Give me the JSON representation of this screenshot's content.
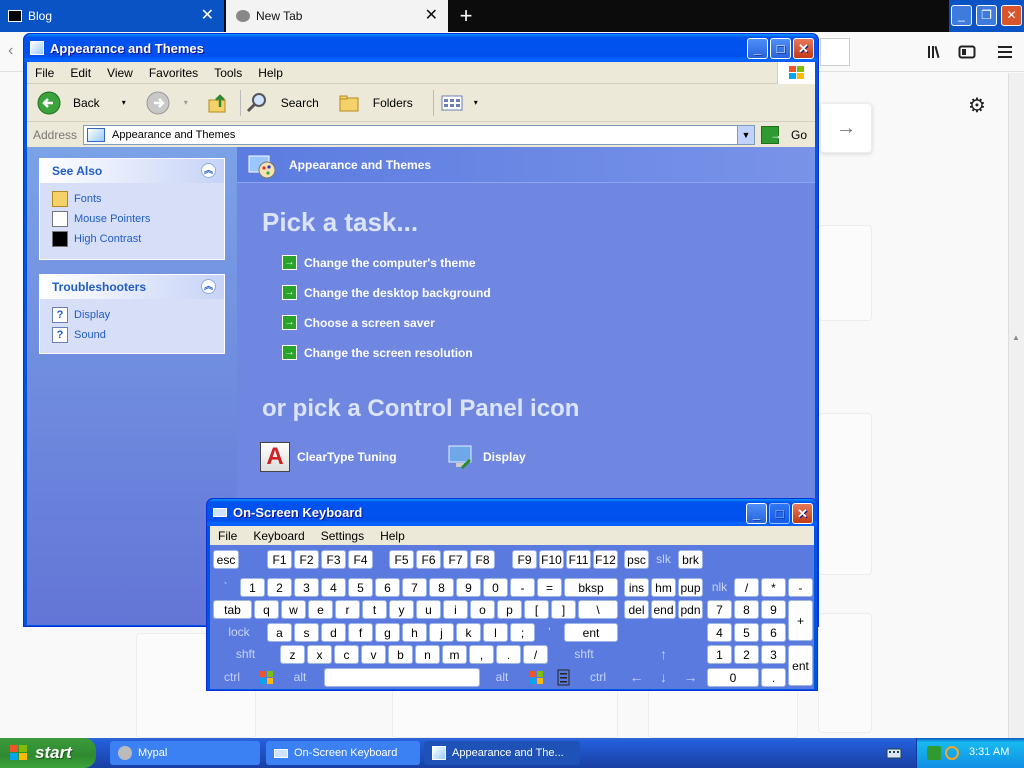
{
  "browser": {
    "tabs": [
      {
        "label": "Blog"
      },
      {
        "label": "New Tab"
      }
    ],
    "close_glyph": "✕",
    "new_tab_glyph": "+",
    "forward_glyph": "→",
    "settings_glyph": "⚙"
  },
  "explorer": {
    "title": "Appearance and Themes",
    "menu": [
      "File",
      "Edit",
      "View",
      "Favorites",
      "Tools",
      "Help"
    ],
    "toolbar": {
      "back": "Back",
      "search": "Search",
      "folders": "Folders"
    },
    "address_label": "Address",
    "address_value": "Appearance and Themes",
    "go_label": "Go",
    "see_also": {
      "title": "See Also",
      "items": [
        "Fonts",
        "Mouse Pointers",
        "High Contrast"
      ]
    },
    "troubleshooters": {
      "title": "Troubleshooters",
      "items": [
        "Display",
        "Sound"
      ]
    },
    "header": "Appearance and Themes",
    "pick_task": "Pick a task...",
    "tasks": [
      "Change the computer's theme",
      "Change the desktop background",
      "Choose a screen saver",
      "Change the screen resolution"
    ],
    "pick_icon": "or pick a Control Panel icon",
    "icons": [
      "ClearType Tuning",
      "Display"
    ]
  },
  "osk": {
    "title": "On-Screen Keyboard",
    "menu": [
      "File",
      "Keyboard",
      "Settings",
      "Help"
    ],
    "keys": {
      "esc": "esc",
      "f1": "F1",
      "f2": "F2",
      "f3": "F3",
      "f4": "F4",
      "f5": "F5",
      "f6": "F6",
      "f7": "F7",
      "f8": "F8",
      "f9": "F9",
      "f10": "F10",
      "f11": "F11",
      "f12": "F12",
      "psc": "psc",
      "slk": "slk",
      "brk": "brk",
      "backtick": "`",
      "n1": "1",
      "n2": "2",
      "n3": "3",
      "n4": "4",
      "n5": "5",
      "n6": "6",
      "n7": "7",
      "n8": "8",
      "n9": "9",
      "n0": "0",
      "minus": "-",
      "equals": "=",
      "bksp": "bksp",
      "ins": "ins",
      "hm": "hm",
      "pup": "pup",
      "nlk": "nlk",
      "kslash": "/",
      "kstar": "*",
      "kminus": "-",
      "tab": "tab",
      "q": "q",
      "w": "w",
      "e": "e",
      "r": "r",
      "t": "t",
      "y": "y",
      "u": "u",
      "i": "i",
      "o": "o",
      "p": "p",
      "lbr": "[",
      "rbr": "]",
      "bslash": "\\",
      "del": "del",
      "end": "end",
      "pdn": "pdn",
      "k7": "7",
      "k8": "8",
      "k9": "9",
      "kplus": "+",
      "lock": "lock",
      "a": "a",
      "s": "s",
      "d": "d",
      "f": "f",
      "g": "g",
      "h": "h",
      "j": "j",
      "k": "k",
      "l": "l",
      "semi": ";",
      "quote": "'",
      "ent": "ent",
      "k4": "4",
      "k5": "5",
      "k6": "6",
      "shft": "shft",
      "z": "z",
      "x": "x",
      "c": "c",
      "v": "v",
      "b": "b",
      "n": "n",
      "m": "m",
      "comma": ",",
      "period": ".",
      "slash": "/",
      "rshft": "shft",
      "up": "↑",
      "k1": "1",
      "k2": "2",
      "k3": "3",
      "kent": "ent",
      "ctrl": "ctrl",
      "alt": "alt",
      "ralt": "alt",
      "rctrl": "ctrl",
      "left": "←",
      "down": "↓",
      "right": "→",
      "k0": "0",
      "kdot": "."
    }
  },
  "taskbar": {
    "start": "start",
    "items": [
      "Mypal",
      "On-Screen Keyboard",
      "Appearance and The..."
    ],
    "clock": "3:31 AM"
  }
}
